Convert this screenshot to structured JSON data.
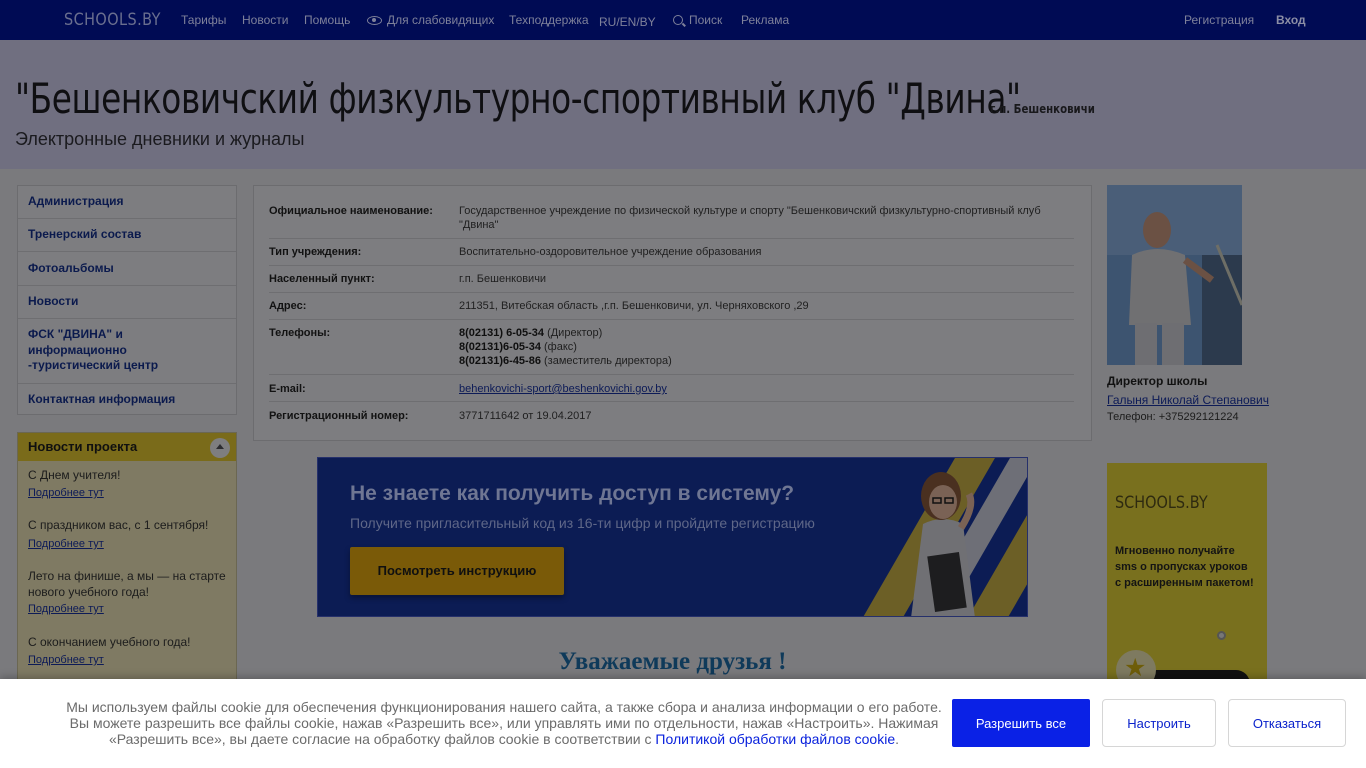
{
  "topnav": {
    "logo": "SCHOOLS.BY",
    "items": [
      "Тарифы",
      "Новости",
      "Помощь",
      "Для слабовидящих",
      "Техподдержка",
      "RU/EN/BY",
      "Поиск",
      "Реклама"
    ],
    "register": "Регистрация",
    "login": "Вход"
  },
  "header": {
    "title": "\"Бешенковичский физкультурно-спортивный клуб \"Двина\"",
    "location": "г.п. Бешенковичи",
    "subtitle": "Электронные дневники и журналы"
  },
  "sidebar": {
    "items": [
      "Администрация",
      "Тренерский состав",
      "Фотоальбомы",
      "Новости",
      "ФСК \"ДВИНА\" и информационно -туристический центр",
      "Контактная информация"
    ]
  },
  "news": {
    "title": "Новости проекта",
    "items": [
      {
        "title": "С Днем учителя!",
        "link": "Подробнее тут"
      },
      {
        "title": "С праздником вас, с 1 сентября!",
        "link": "Подробнее тут"
      },
      {
        "title": "Лето на финише, а мы — на старте нового учебного года!",
        "link": "Подробнее тут"
      },
      {
        "title": "С окончанием учебного года!",
        "link": "Подробнее тут"
      }
    ]
  },
  "info": {
    "official_name_label": "Официальное наименование:",
    "official_name": "Государственное учреждение по физической культуре и спорту \"Бешенковичский физкультурно-спортивный клуб \"Двина\"",
    "type_label": "Тип учреждения:",
    "type": "Воспитательно-оздоровительное учреждение образования",
    "locality_label": "Населенный пункт:",
    "locality": "г.п. Бешенковичи",
    "address_label": "Адрес:",
    "address": "211351, Витебская область ,г.п. Бешенковичи, ул. Черняховского ,29",
    "phones_label": "Телефоны:",
    "phones": [
      {
        "number": "8(02131) 6-05-34",
        "note": " (Директор)"
      },
      {
        "number": "8(02131)6-05-34",
        "note": " (факс)"
      },
      {
        "number": "8(02131)6-45-86",
        "note": " (заместитель директора)"
      }
    ],
    "email_label": "E-mail:",
    "email": "behenkovichi-sport@beshenkovichi.gov.by",
    "reg_label": "Регистрационный номер:",
    "reg": "3771711642 от 19.04.2017"
  },
  "banner": {
    "heading": "Не знаете как получить доступ в систему?",
    "sub": "Получите пригласительный код из 16-ти цифр и пройдите регистрацию",
    "button": "Посмотреть инструкцию"
  },
  "greeting": "Уважаемые друзья !",
  "director": {
    "role": "Директор школы",
    "name": "Галыня Николай Степанович",
    "phone": "Телефон: +375292121224"
  },
  "ad": {
    "logo": "SCHOOLS.BY",
    "text": "Мгновенно получайте sms о пропусках уроков с расширенным пакетом!"
  },
  "cookie": {
    "text": "Мы используем файлы cookie для обеспечения функционирования нашего сайта, а также сбора и анализа информации о его работе. Вы можете разрешить все файлы cookie, нажав «Разрешить все», или управлять ими по отдельности, нажав «Настроить». Нажимая «Разрешить все», вы даете согласие на обработку файлов cookie в соответствии с ",
    "policy_link": "Политикой обработки файлов cookie",
    "allow": "Разрешить все",
    "config": "Настроить",
    "refuse": "Отказаться"
  },
  "colors": {
    "nav_bg": "#000b54",
    "allow_button": "#0a21e6",
    "link": "#0a22dd"
  }
}
